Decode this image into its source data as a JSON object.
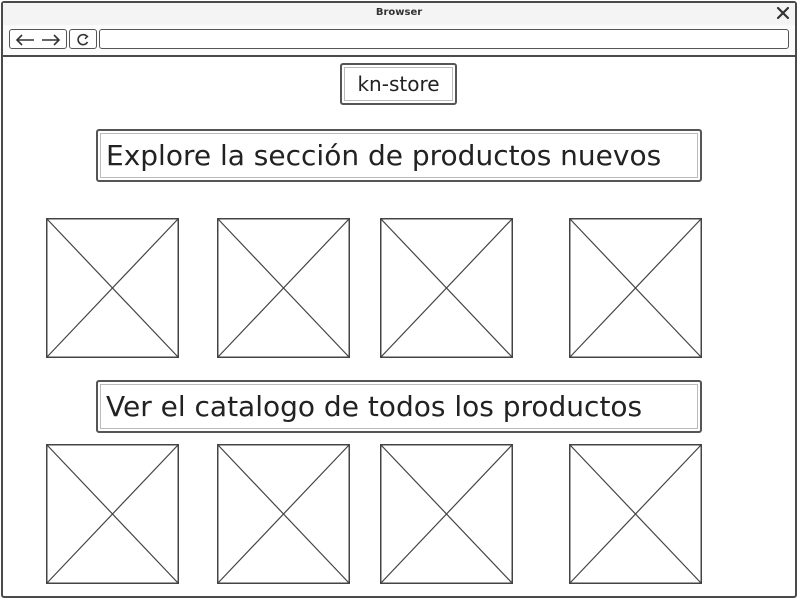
{
  "window": {
    "title": "Browser"
  },
  "toolbar": {
    "back_icon": "arrow-left-icon",
    "forward_icon": "arrow-right-icon",
    "reload_icon": "reload-icon",
    "url": ""
  },
  "header": {
    "store_name": "kn-store"
  },
  "sections": [
    {
      "label": "Explore la sección de productos nuevos",
      "images": [
        "image-placeholder",
        "image-placeholder",
        "image-placeholder",
        "image-placeholder"
      ]
    },
    {
      "label": "Ver el catalogo de todos los productos",
      "images": [
        "image-placeholder",
        "image-placeholder",
        "image-placeholder",
        "image-placeholder"
      ]
    }
  ]
}
